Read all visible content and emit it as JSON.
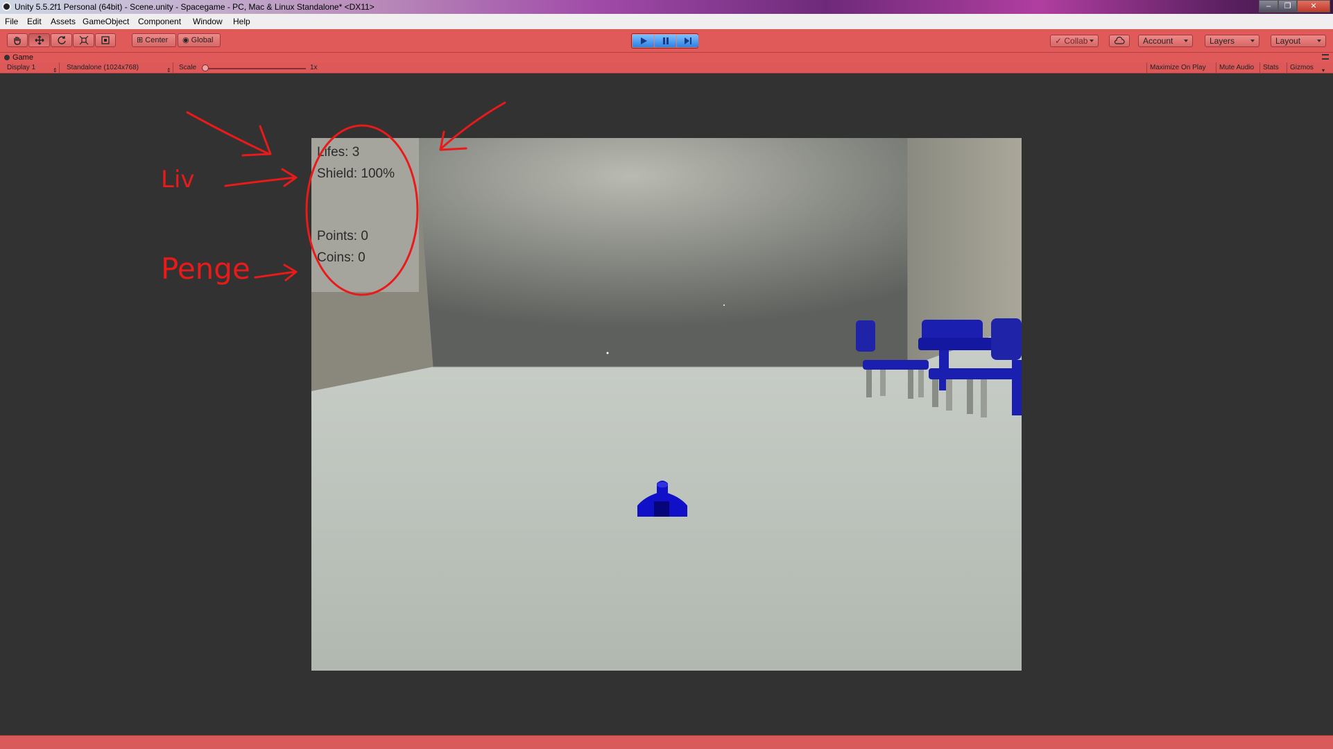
{
  "window": {
    "title": "Unity 5.5.2f1 Personal (64bit) - Scene.unity - Spacegame - PC, Mac & Linux Standalone* <DX11>",
    "minimize": "–",
    "maximize": "❐",
    "close": "✕"
  },
  "menu": {
    "items": [
      "File",
      "Edit",
      "Assets",
      "GameObject",
      "Component",
      "Window",
      "Help"
    ]
  },
  "toolbar": {
    "tools": [
      "hand-tool",
      "move-tool",
      "rotate-tool",
      "scale-tool",
      "rect-tool"
    ],
    "pivot_label": "Center",
    "space_label": "Global",
    "collab_label": "Collab",
    "account_label": "Account",
    "layers_label": "Layers",
    "layout_label": "Layout"
  },
  "game_view": {
    "tab_label": "Game",
    "display_label": "Display 1",
    "resolution_label": "Standalone (1024x768)",
    "scale_label": "Scale",
    "scale_value": "1x",
    "maximize_label": "Maximize On Play",
    "mute_label": "Mute Audio",
    "stats_label": "Stats",
    "gizmos_label": "Gizmos"
  },
  "hud": {
    "lifes": "Lifes: 3",
    "shield": "Shield: 100%",
    "points": "Points: 0",
    "coins": "Coins: 0"
  },
  "annotations": {
    "liv": "Liv",
    "penge": "Penge"
  },
  "colors": {
    "play_accent": "#2f80e0",
    "toolbar": "#e05a5a",
    "annotation": "#e81a1a",
    "ship": "#1010c8"
  }
}
